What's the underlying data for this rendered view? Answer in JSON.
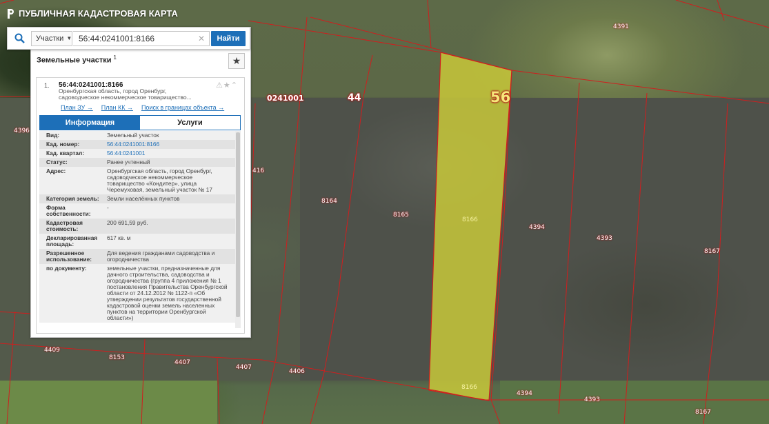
{
  "app": {
    "title": "ПУБЛИЧНАЯ КАДАСТРОВАЯ КАРТА"
  },
  "search": {
    "type_label": "Участки",
    "query": "56:44:0241001:8166",
    "find_label": "Найти"
  },
  "results": {
    "header": "Земельные участки",
    "count": "1",
    "item": {
      "index": "1.",
      "number": "56:44:0241001:8166",
      "address_short": "Оренбургская область, город Оренбург, садоводческое некоммерческое товарищество...",
      "links": [
        "План ЗУ →",
        "План КК →",
        "Поиск в границах объекта →"
      ]
    }
  },
  "tabs": [
    "Информация",
    "Услуги"
  ],
  "info": [
    {
      "k": "Вид:",
      "v": "Земельный участок"
    },
    {
      "k": "Кад. номер:",
      "v": "56:44:0241001:8166",
      "link": true
    },
    {
      "k": "Кад. квартал:",
      "v": "56:44:0241001",
      "link": true
    },
    {
      "k": "Статус:",
      "v": "Ранее учтенный"
    },
    {
      "k": "Адрес:",
      "v": "Оренбургская область, город Оренбург, садоводческое некоммерческое товарищество «Кондитер», улица Черемуховая, земельный участок № 17"
    },
    {
      "k": "Категория земель:",
      "v": "Земли населённых пунктов"
    },
    {
      "k": "Форма собственности:",
      "v": "-"
    },
    {
      "k": "Кадастровая стоимость:",
      "v": "200 691,59 руб."
    },
    {
      "k": "Декларированная площадь:",
      "v": "617 кв. м"
    },
    {
      "k": "Разрешенное использование:",
      "v": "Для ведения гражданами садоводства и огородничества"
    },
    {
      "k": "по документу:",
      "v": "земельные участки, предназначенные для дачного строительства, садоводства и огородничества (группа 4 приложения № 1 постановления Правительства Оренбургской области от 24.12.2012 № 1122-п «Об утверждении результатов государственной кадастровой оценки земель населенных пунктов на территории Оренбургской области»)"
    }
  ],
  "map": {
    "block_labels": [
      "0241001",
      "44",
      "56"
    ],
    "parcel_labels": [
      "4391",
      "4396",
      "416",
      "8164",
      "8165",
      "8166",
      "4394",
      "4393",
      "8167",
      "4409",
      "8153",
      "4407",
      "4407",
      "4406",
      "8166",
      "4394",
      "4393",
      "8167"
    ]
  },
  "colors": {
    "accent": "#1d6fb8",
    "parcel_fill": "#c8c83a",
    "boundary": "#d01e1e"
  }
}
